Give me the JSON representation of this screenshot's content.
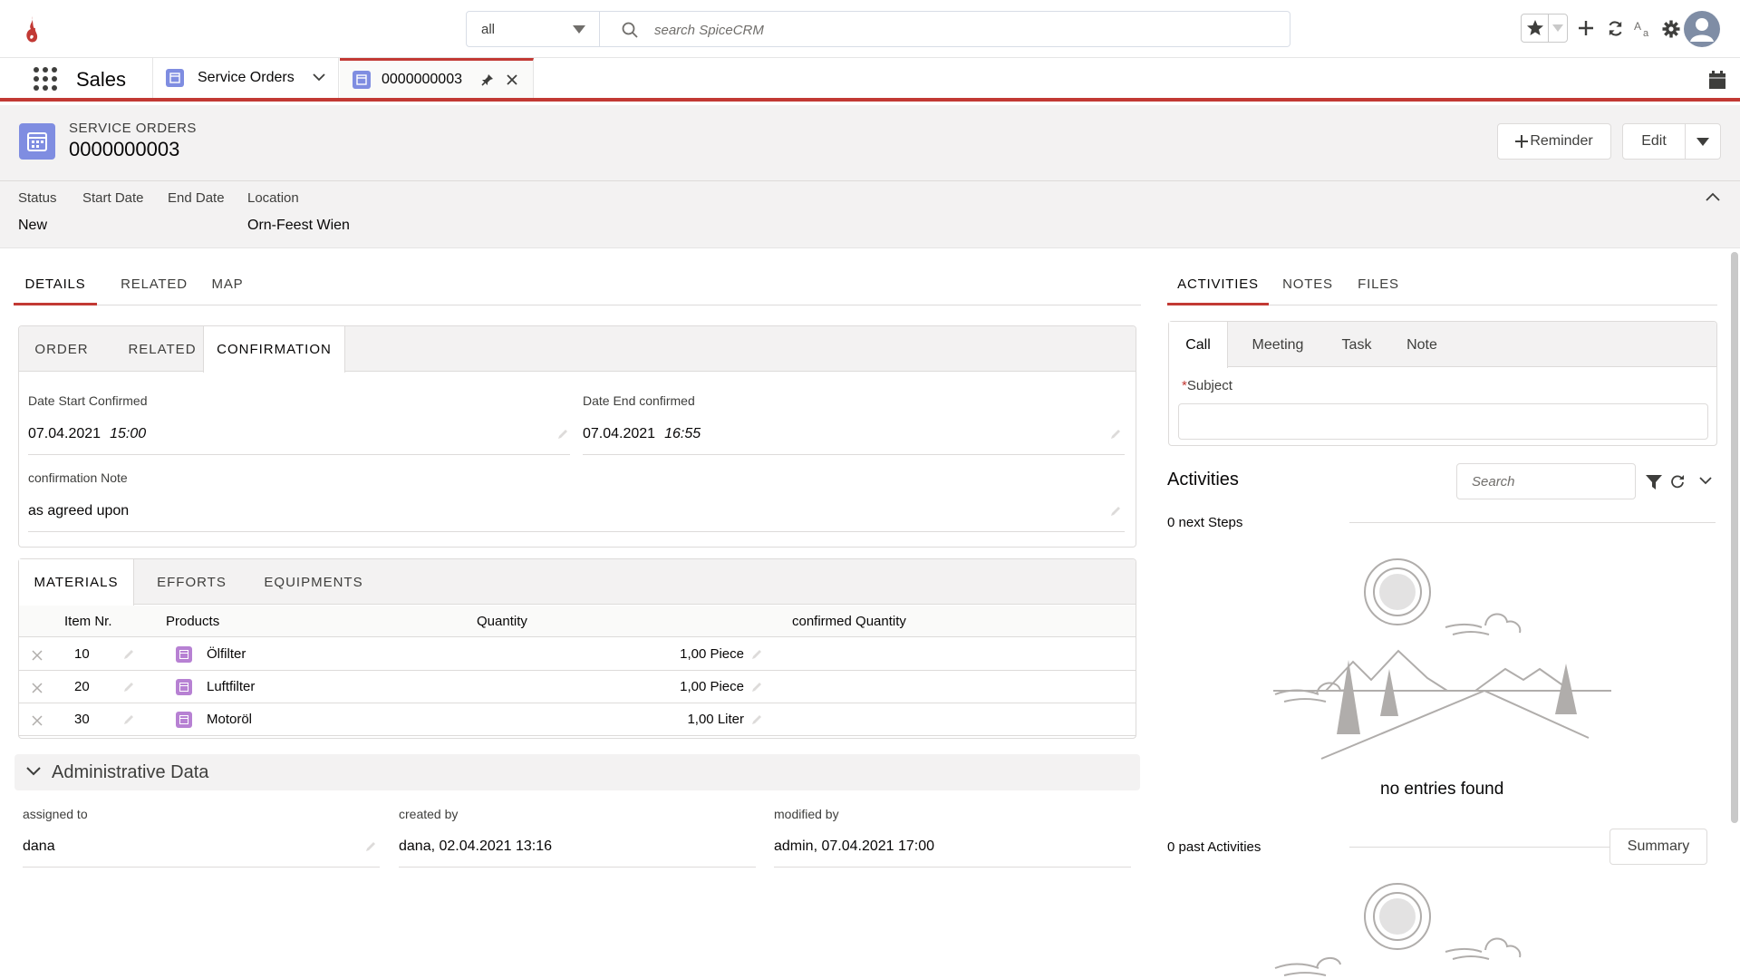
{
  "topbar": {
    "scope_value": "all",
    "search_placeholder": "search SpiceCRM"
  },
  "navbar": {
    "app_name": "Sales",
    "tabs": [
      {
        "label": "Service Orders"
      },
      {
        "label": "0000000003"
      }
    ]
  },
  "record": {
    "type": "SERVICE ORDERS",
    "name": "0000000003",
    "reminder_label": "Reminder",
    "edit_label": "Edit"
  },
  "highlights": {
    "status_label": "Status",
    "status_value": "New",
    "start_label": "Start Date",
    "end_label": "End Date",
    "location_label": "Location",
    "location_value": "Orn-Feest Wien"
  },
  "main_tabs": [
    "DETAILS",
    "RELATED",
    "MAP"
  ],
  "confirmation": {
    "subtabs": [
      "ORDER",
      "RELATED",
      "CONFIRMATION"
    ],
    "date_start_label": "Date Start Confirmed",
    "date_start_date": "07.04.2021",
    "date_start_time": "15:00",
    "date_end_label": "Date End confirmed",
    "date_end_date": "07.04.2021",
    "date_end_time": "16:55",
    "note_label": "confirmation Note",
    "note_value": "as agreed upon"
  },
  "materials": {
    "subtabs": [
      "MATERIALS",
      "EFFORTS",
      "EQUIPMENTS"
    ],
    "headers": [
      "Item Nr.",
      "Products",
      "Quantity",
      "confirmed Quantity"
    ],
    "rows": [
      {
        "item": "10",
        "product": "Ölfilter",
        "quantity": "1,00 Piece"
      },
      {
        "item": "20",
        "product": "Luftfilter",
        "quantity": "1,00 Piece"
      },
      {
        "item": "30",
        "product": "Motoröl",
        "quantity": "1,00 Liter"
      }
    ]
  },
  "admin": {
    "title": "Administrative Data",
    "assigned_label": "assigned to",
    "assigned_value": "dana",
    "created_label": "created by",
    "created_value": "dana, 02.04.2021 13:16",
    "modified_label": "modified by",
    "modified_value": "admin, 07.04.2021 17:00"
  },
  "right_tabs": [
    "ACTIVITIES",
    "NOTES",
    "FILES"
  ],
  "composer": {
    "tabs": [
      "Call",
      "Meeting",
      "Task",
      "Note"
    ],
    "required_mark": "*",
    "subject_label": "Subject"
  },
  "activities": {
    "title": "Activities",
    "search_placeholder": "Search",
    "next_steps": "0 next Steps",
    "no_entries": "no entries found",
    "past_activities": "0 past Activities",
    "summary_label": "Summary"
  },
  "colors": {
    "accent_red": "#c23934",
    "record_icon": "#7f8de1",
    "product_icon": "#b781d3"
  }
}
